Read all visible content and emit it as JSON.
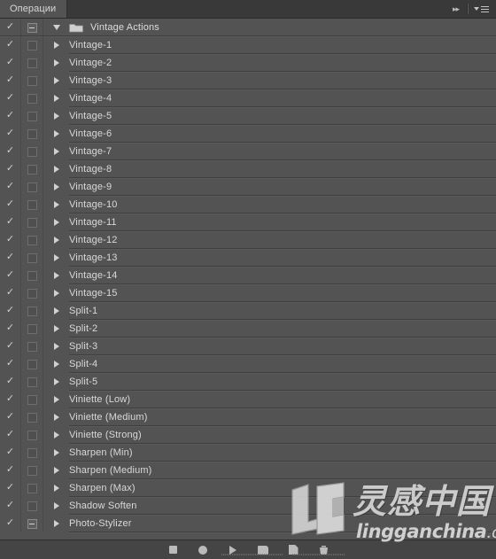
{
  "window": {
    "title": "Операции"
  },
  "tabbar": {
    "active_tab": "Операции",
    "collapse_icon": "double-chevron-right-icon",
    "menu_icon": "panel-menu-icon"
  },
  "list": {
    "rows": [
      {
        "label": "Vintage Actions",
        "type": "set",
        "checked": true,
        "dialog": "dash",
        "expanded": true,
        "indent": 0
      },
      {
        "label": "Vintage-1",
        "type": "action",
        "checked": true,
        "dialog": "empty",
        "expanded": false,
        "indent": 1
      },
      {
        "label": "Vintage-2",
        "type": "action",
        "checked": true,
        "dialog": "empty",
        "expanded": false,
        "indent": 1
      },
      {
        "label": "Vintage-3",
        "type": "action",
        "checked": true,
        "dialog": "empty",
        "expanded": false,
        "indent": 1
      },
      {
        "label": "Vintage-4",
        "type": "action",
        "checked": true,
        "dialog": "empty",
        "expanded": false,
        "indent": 1
      },
      {
        "label": "Vintage-5",
        "type": "action",
        "checked": true,
        "dialog": "empty",
        "expanded": false,
        "indent": 1
      },
      {
        "label": "Vintage-6",
        "type": "action",
        "checked": true,
        "dialog": "empty",
        "expanded": false,
        "indent": 1
      },
      {
        "label": "Vintage-7",
        "type": "action",
        "checked": true,
        "dialog": "empty",
        "expanded": false,
        "indent": 1
      },
      {
        "label": "Vintage-8",
        "type": "action",
        "checked": true,
        "dialog": "empty",
        "expanded": false,
        "indent": 1
      },
      {
        "label": "Vintage-9",
        "type": "action",
        "checked": true,
        "dialog": "empty",
        "expanded": false,
        "indent": 1
      },
      {
        "label": "Vintage-10",
        "type": "action",
        "checked": true,
        "dialog": "empty",
        "expanded": false,
        "indent": 1
      },
      {
        "label": "Vintage-11",
        "type": "action",
        "checked": true,
        "dialog": "empty",
        "expanded": false,
        "indent": 1
      },
      {
        "label": "Vintage-12",
        "type": "action",
        "checked": true,
        "dialog": "empty",
        "expanded": false,
        "indent": 1
      },
      {
        "label": "Vintage-13",
        "type": "action",
        "checked": true,
        "dialog": "empty",
        "expanded": false,
        "indent": 1
      },
      {
        "label": "Vintage-14",
        "type": "action",
        "checked": true,
        "dialog": "empty",
        "expanded": false,
        "indent": 1
      },
      {
        "label": "Vintage-15",
        "type": "action",
        "checked": true,
        "dialog": "empty",
        "expanded": false,
        "indent": 1
      },
      {
        "label": "Split-1",
        "type": "action",
        "checked": true,
        "dialog": "empty",
        "expanded": false,
        "indent": 1
      },
      {
        "label": "Split-2",
        "type": "action",
        "checked": true,
        "dialog": "empty",
        "expanded": false,
        "indent": 1
      },
      {
        "label": "Split-3",
        "type": "action",
        "checked": true,
        "dialog": "empty",
        "expanded": false,
        "indent": 1
      },
      {
        "label": "Split-4",
        "type": "action",
        "checked": true,
        "dialog": "empty",
        "expanded": false,
        "indent": 1
      },
      {
        "label": "Split-5",
        "type": "action",
        "checked": true,
        "dialog": "empty",
        "expanded": false,
        "indent": 1
      },
      {
        "label": "Viniette (Low)",
        "type": "action",
        "checked": true,
        "dialog": "empty",
        "expanded": false,
        "indent": 1
      },
      {
        "label": "Viniette (Medium)",
        "type": "action",
        "checked": true,
        "dialog": "empty",
        "expanded": false,
        "indent": 1
      },
      {
        "label": "Viniette (Strong)",
        "type": "action",
        "checked": true,
        "dialog": "empty",
        "expanded": false,
        "indent": 1
      },
      {
        "label": "Sharpen (Min)",
        "type": "action",
        "checked": true,
        "dialog": "empty",
        "expanded": false,
        "indent": 1
      },
      {
        "label": "Sharpen (Medium)",
        "type": "action",
        "checked": true,
        "dialog": "empty",
        "expanded": false,
        "indent": 1
      },
      {
        "label": "Sharpen (Max)",
        "type": "action",
        "checked": true,
        "dialog": "empty",
        "expanded": false,
        "indent": 1
      },
      {
        "label": "Shadow Soften",
        "type": "action",
        "checked": true,
        "dialog": "empty",
        "expanded": false,
        "indent": 1
      },
      {
        "label": "Photo-Stylizer",
        "type": "action",
        "checked": true,
        "dialog": "dash",
        "expanded": false,
        "indent": 1
      }
    ],
    "check_glyph": "✓"
  },
  "toolbar": {
    "buttons": [
      {
        "name": "stop-button",
        "icon": "stop-icon"
      },
      {
        "name": "record-button",
        "icon": "record-icon"
      },
      {
        "name": "play-button",
        "icon": "play-icon"
      },
      {
        "name": "new-set-button",
        "icon": "new-folder-icon"
      },
      {
        "name": "new-action-button",
        "icon": "new-page-icon"
      },
      {
        "name": "delete-button",
        "icon": "trash-icon"
      }
    ]
  },
  "watermark": {
    "chinese": "灵感中国",
    "english": "lingganchina",
    "tld": ".com",
    "logo": "lg-logo"
  },
  "colors": {
    "panel_bg": "#535353",
    "tabbar_bg": "#393939",
    "toolbar_bg": "#454545",
    "text": "#d9d9d9",
    "separator": "#3f3f3f"
  }
}
